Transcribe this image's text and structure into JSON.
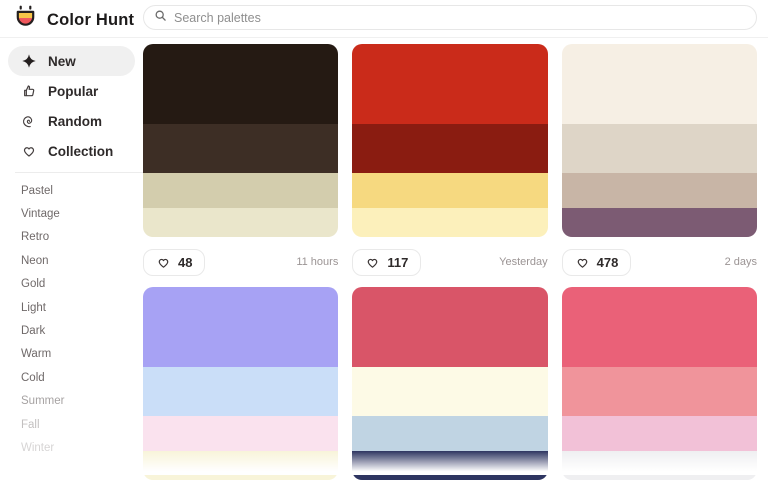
{
  "header": {
    "logo_text": "Color Hunt",
    "search_placeholder": "Search palettes"
  },
  "sidebar": {
    "nav": [
      {
        "label": "New",
        "icon": "new-sparkle-icon",
        "active": true
      },
      {
        "label": "Popular",
        "icon": "popular-thumb-icon",
        "active": false
      },
      {
        "label": "Random",
        "icon": "random-spiral-icon",
        "active": false
      },
      {
        "label": "Collection",
        "icon": "collection-heart-icon",
        "active": false
      }
    ],
    "tags": [
      "Pastel",
      "Vintage",
      "Retro",
      "Neon",
      "Gold",
      "Light",
      "Dark",
      "Warm",
      "Cold",
      "Summer",
      "Fall",
      "Winter"
    ]
  },
  "palettes": [
    {
      "colors": [
        "#251a13",
        "#3d2e25",
        "#d3cdad",
        "#eae6cb"
      ],
      "likes": "48",
      "time": "11 hours"
    },
    {
      "colors": [
        "#ca2b1a",
        "#8a1c11",
        "#f6d980",
        "#fcf0bb"
      ],
      "likes": "117",
      "time": "Yesterday"
    },
    {
      "colors": [
        "#f6efe4",
        "#ded5c7",
        "#c8b5a6",
        "#7c5b73"
      ],
      "likes": "478",
      "time": "2 days"
    },
    {
      "colors": [
        "#a7a2f4",
        "#cadef8",
        "#fae2ee",
        "#f8f4d9"
      ]
    },
    {
      "colors": [
        "#d95568",
        "#fdfae6",
        "#c0d4e3",
        "#2e3561"
      ]
    },
    {
      "colors": [
        "#ea6178",
        "#f0949b",
        "#f2c1d7",
        "#efeff1"
      ]
    }
  ],
  "icons": {
    "logo": "colorhunt-cup",
    "search": "magnifier",
    "new": "four-point-star",
    "popular": "thumbs-up",
    "random": "spiral",
    "collection": "heart-outline",
    "like": "heart-outline"
  },
  "ui_colors": {
    "active_pill_bg": "#f0f0f0",
    "card_border": "#e9e9e9",
    "text_primary": "#2e2a2a",
    "text_muted": "#9b9494",
    "logo_yellow": "#f7c548",
    "logo_red": "#f0575c"
  }
}
